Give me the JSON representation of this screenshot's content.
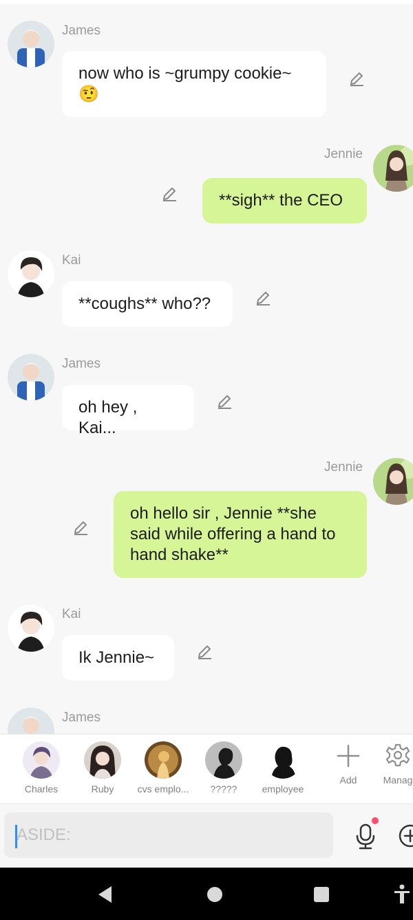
{
  "messages": [
    {
      "sender": "James",
      "text": "now who is ~grumpy cookie~ 🤨",
      "side": "left"
    },
    {
      "sender": "Jennie",
      "text": "**sigh** the CEO",
      "side": "right"
    },
    {
      "sender": "Kai",
      "text": "**coughs** who??",
      "side": "left"
    },
    {
      "sender": "James",
      "text": "oh hey , Kai...",
      "side": "left"
    },
    {
      "sender": "Jennie",
      "text": "oh hello sir , Jennie **she said while offering a hand to hand shake**",
      "side": "right"
    },
    {
      "sender": "Kai",
      "text": "Ik Jennie~",
      "side": "left"
    },
    {
      "sender": "James",
      "text": "",
      "side": "left"
    }
  ],
  "contacts": [
    {
      "label": "Charles",
      "icon": "charles-avatar"
    },
    {
      "label": "Ruby",
      "icon": "ruby-avatar"
    },
    {
      "label": "cvs emplo...",
      "icon": "cvs-employee-avatar"
    },
    {
      "label": "?????",
      "icon": "silhouette-avatar"
    },
    {
      "label": "employee",
      "icon": "employee-avatar"
    }
  ],
  "actions": {
    "add_label": "Add",
    "manage_label": "Manag"
  },
  "input": {
    "placeholder": "ASIDE:"
  },
  "colors": {
    "my_bubble": "#d6f596",
    "their_bubble": "#ffffff",
    "background": "#f7f7f7",
    "mic_dot": "#ff4d6d"
  }
}
